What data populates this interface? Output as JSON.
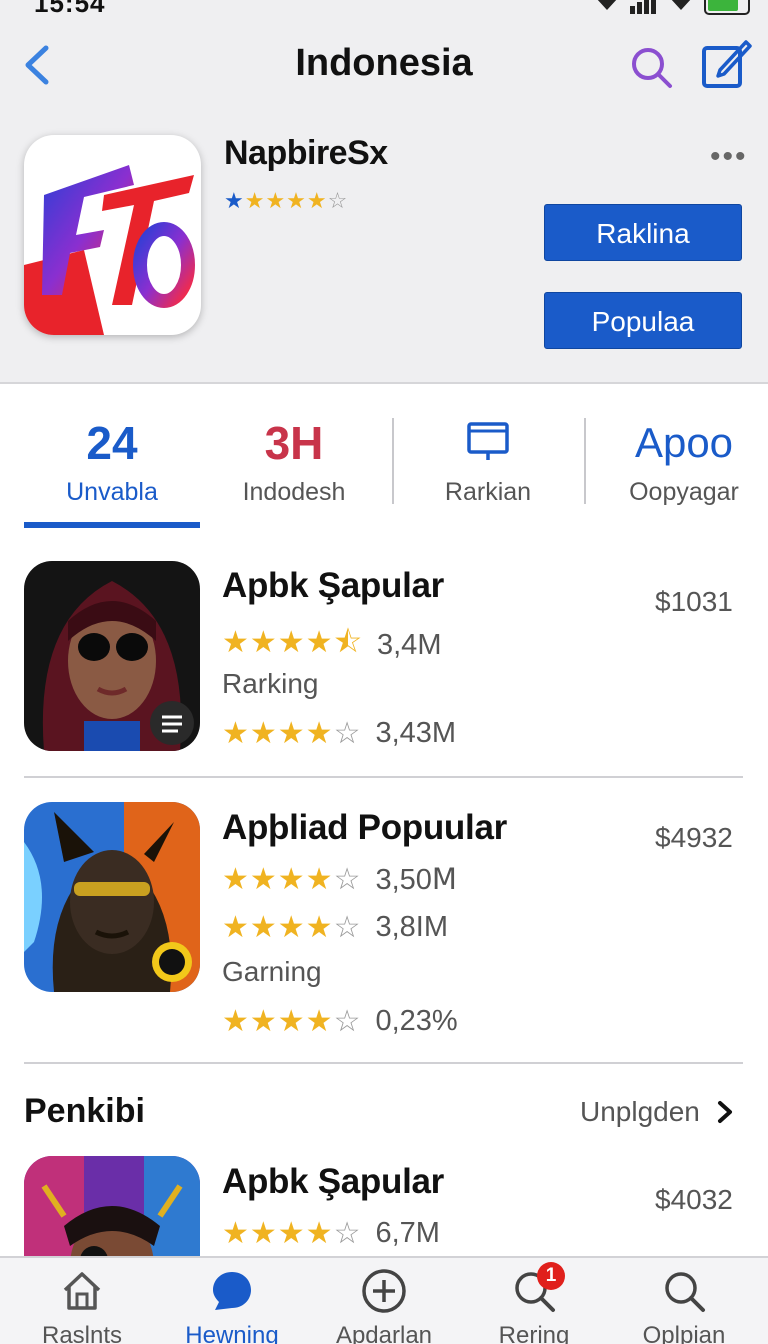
{
  "status": {
    "time": "15:54",
    "battery_color": "#3cb43c"
  },
  "nav": {
    "title": "Indonesia",
    "back_icon": "chevron-left-icon",
    "search_icon": "search-icon",
    "compose_icon": "compose-icon",
    "accent": "#3b82e0"
  },
  "hero": {
    "name": "NapbireSx",
    "rating_stars": 4,
    "buttons": [
      "Raklina",
      "Populaa"
    ],
    "button_color": "#1a5bc9"
  },
  "stats": [
    {
      "value": "24",
      "label": "Unvabla",
      "value_color": "#1a5bc9",
      "label_color": "#1a5bc9",
      "active": true
    },
    {
      "value": "3H",
      "label": "Indodesh",
      "value_color": "#c8344a",
      "label_color": "#555555"
    },
    {
      "value": "",
      "label": "Rarkian",
      "icon": "monitor-icon"
    },
    {
      "value": "Apoo",
      "label": "Oopyagar",
      "value_color": "#1a5bc9",
      "label_color": "#555555"
    }
  ],
  "apps": [
    {
      "name": "Apbk Şapular",
      "price": "$1031",
      "ratings": [
        {
          "stars": 4.5,
          "text": "3,4M"
        }
      ],
      "category": "Rarking",
      "ratings2": [
        {
          "stars": 4,
          "text": "3,43M"
        }
      ]
    },
    {
      "name": "Apþliad Popuular",
      "price": "$4932",
      "ratings": [
        {
          "stars": 4,
          "text": "3,50Ⅿ"
        },
        {
          "stars": 4,
          "text": "3,8IM"
        }
      ],
      "category": "Garning",
      "ratings2": [
        {
          "stars": 4,
          "text": "0,23%"
        }
      ]
    }
  ],
  "section": {
    "title": "Penkibi",
    "link": "Unplgden",
    "link_icon": "chevron-right-icon"
  },
  "featured": {
    "name": "Apbk Şapular",
    "price": "$4032",
    "rating": {
      "stars": 4,
      "text": "6,7M"
    }
  },
  "tabs": [
    {
      "label": "Raslnts",
      "icon": "home-icon"
    },
    {
      "label": "Hewning",
      "icon": "chat-bubble-icon",
      "active": true
    },
    {
      "label": "Apdarlan",
      "icon": "plus-circle-icon"
    },
    {
      "label": "Rering",
      "icon": "search-icon",
      "badge": "1"
    },
    {
      "label": "Oplpian",
      "icon": "search-icon"
    }
  ]
}
